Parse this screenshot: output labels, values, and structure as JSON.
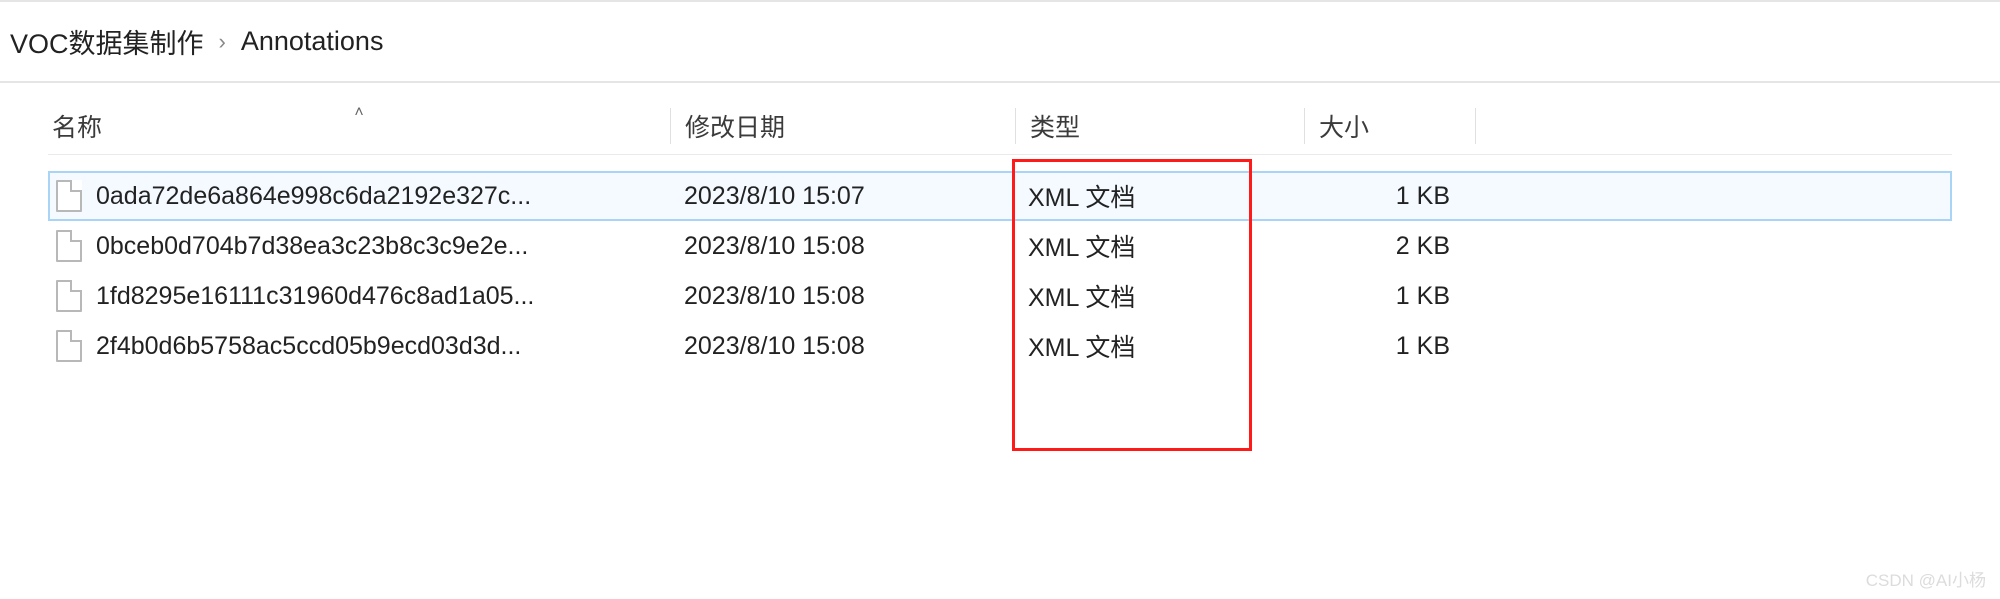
{
  "breadcrumb": {
    "parent": "VOC数据集制作",
    "current": "Annotations"
  },
  "columns": {
    "name": "名称",
    "date": "修改日期",
    "type": "类型",
    "size": "大小"
  },
  "rows": [
    {
      "name": "0ada72de6a864e998c6da2192e327c...",
      "date": "2023/8/10 15:07",
      "type": "XML 文档",
      "size": "1 KB",
      "selected": true
    },
    {
      "name": "0bceb0d704b7d38ea3c23b8c3c9e2e...",
      "date": "2023/8/10 15:08",
      "type": "XML 文档",
      "size": "2 KB",
      "selected": false
    },
    {
      "name": "1fd8295e16111c31960d476c8ad1a05...",
      "date": "2023/8/10 15:08",
      "type": "XML 文档",
      "size": "1 KB",
      "selected": false
    },
    {
      "name": "2f4b0d6b5758ac5ccd05b9ecd03d3d...",
      "date": "2023/8/10 15:08",
      "type": "XML 文档",
      "size": "1 KB",
      "selected": false
    }
  ],
  "watermark": "CSDN @AI小杨"
}
